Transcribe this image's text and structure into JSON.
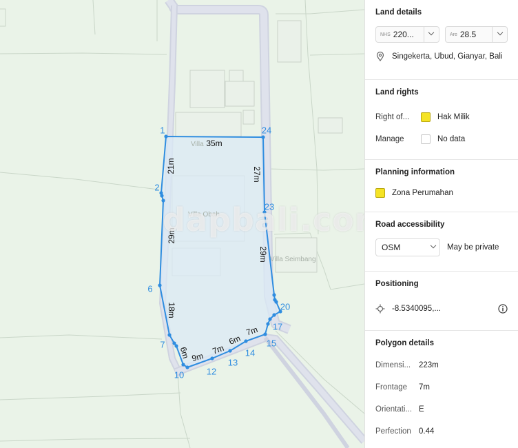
{
  "map": {
    "watermark": "dapbali.com",
    "place_labels": [
      "Villa",
      "Villa Obah",
      "Villa Seimbang"
    ],
    "vertex_labels": [
      "1",
      "2",
      "6",
      "7",
      "10",
      "12",
      "13",
      "14",
      "15",
      "17",
      "20",
      "23",
      "24"
    ],
    "edge_labels": [
      "35m",
      "21m",
      "27m",
      "29m",
      "29m",
      "18m",
      "6m",
      "9m",
      "7m",
      "6m",
      "7m"
    ],
    "colors": {
      "polygon_stroke": "#2f8de0",
      "polygon_fill": "#dbe9f6",
      "road": "#d8dbe6",
      "label": "#2f8de0"
    }
  },
  "panel": {
    "land_details": {
      "title": "Land details",
      "nhs_prefix": "NHS",
      "nhs_value": "220...",
      "are_prefix": "Are",
      "are_value": "28.5",
      "location": "Singekerta, Ubud, Gianyar, Bali"
    },
    "land_rights": {
      "title": "Land rights",
      "rows": [
        {
          "label": "Right of...",
          "value": "Hak Milik",
          "swatch": "#f5e325"
        },
        {
          "label": "Manage",
          "value": "No data",
          "swatch": "#ffffff"
        }
      ]
    },
    "planning": {
      "title": "Planning information",
      "zone": "Zona Perumahan",
      "swatch": "#f5e325"
    },
    "road": {
      "title": "Road accessibility",
      "select_value": "OSM",
      "note": "May be private"
    },
    "positioning": {
      "title": "Positioning",
      "coords": "-8.5340095,..."
    },
    "polygon": {
      "title": "Polygon details",
      "rows": [
        {
          "label": "Dimensi...",
          "value": "223m"
        },
        {
          "label": "Frontage",
          "value": "7m"
        },
        {
          "label": "Orientati...",
          "value": "E"
        },
        {
          "label": "Perfection",
          "value": "0.44"
        }
      ]
    }
  }
}
